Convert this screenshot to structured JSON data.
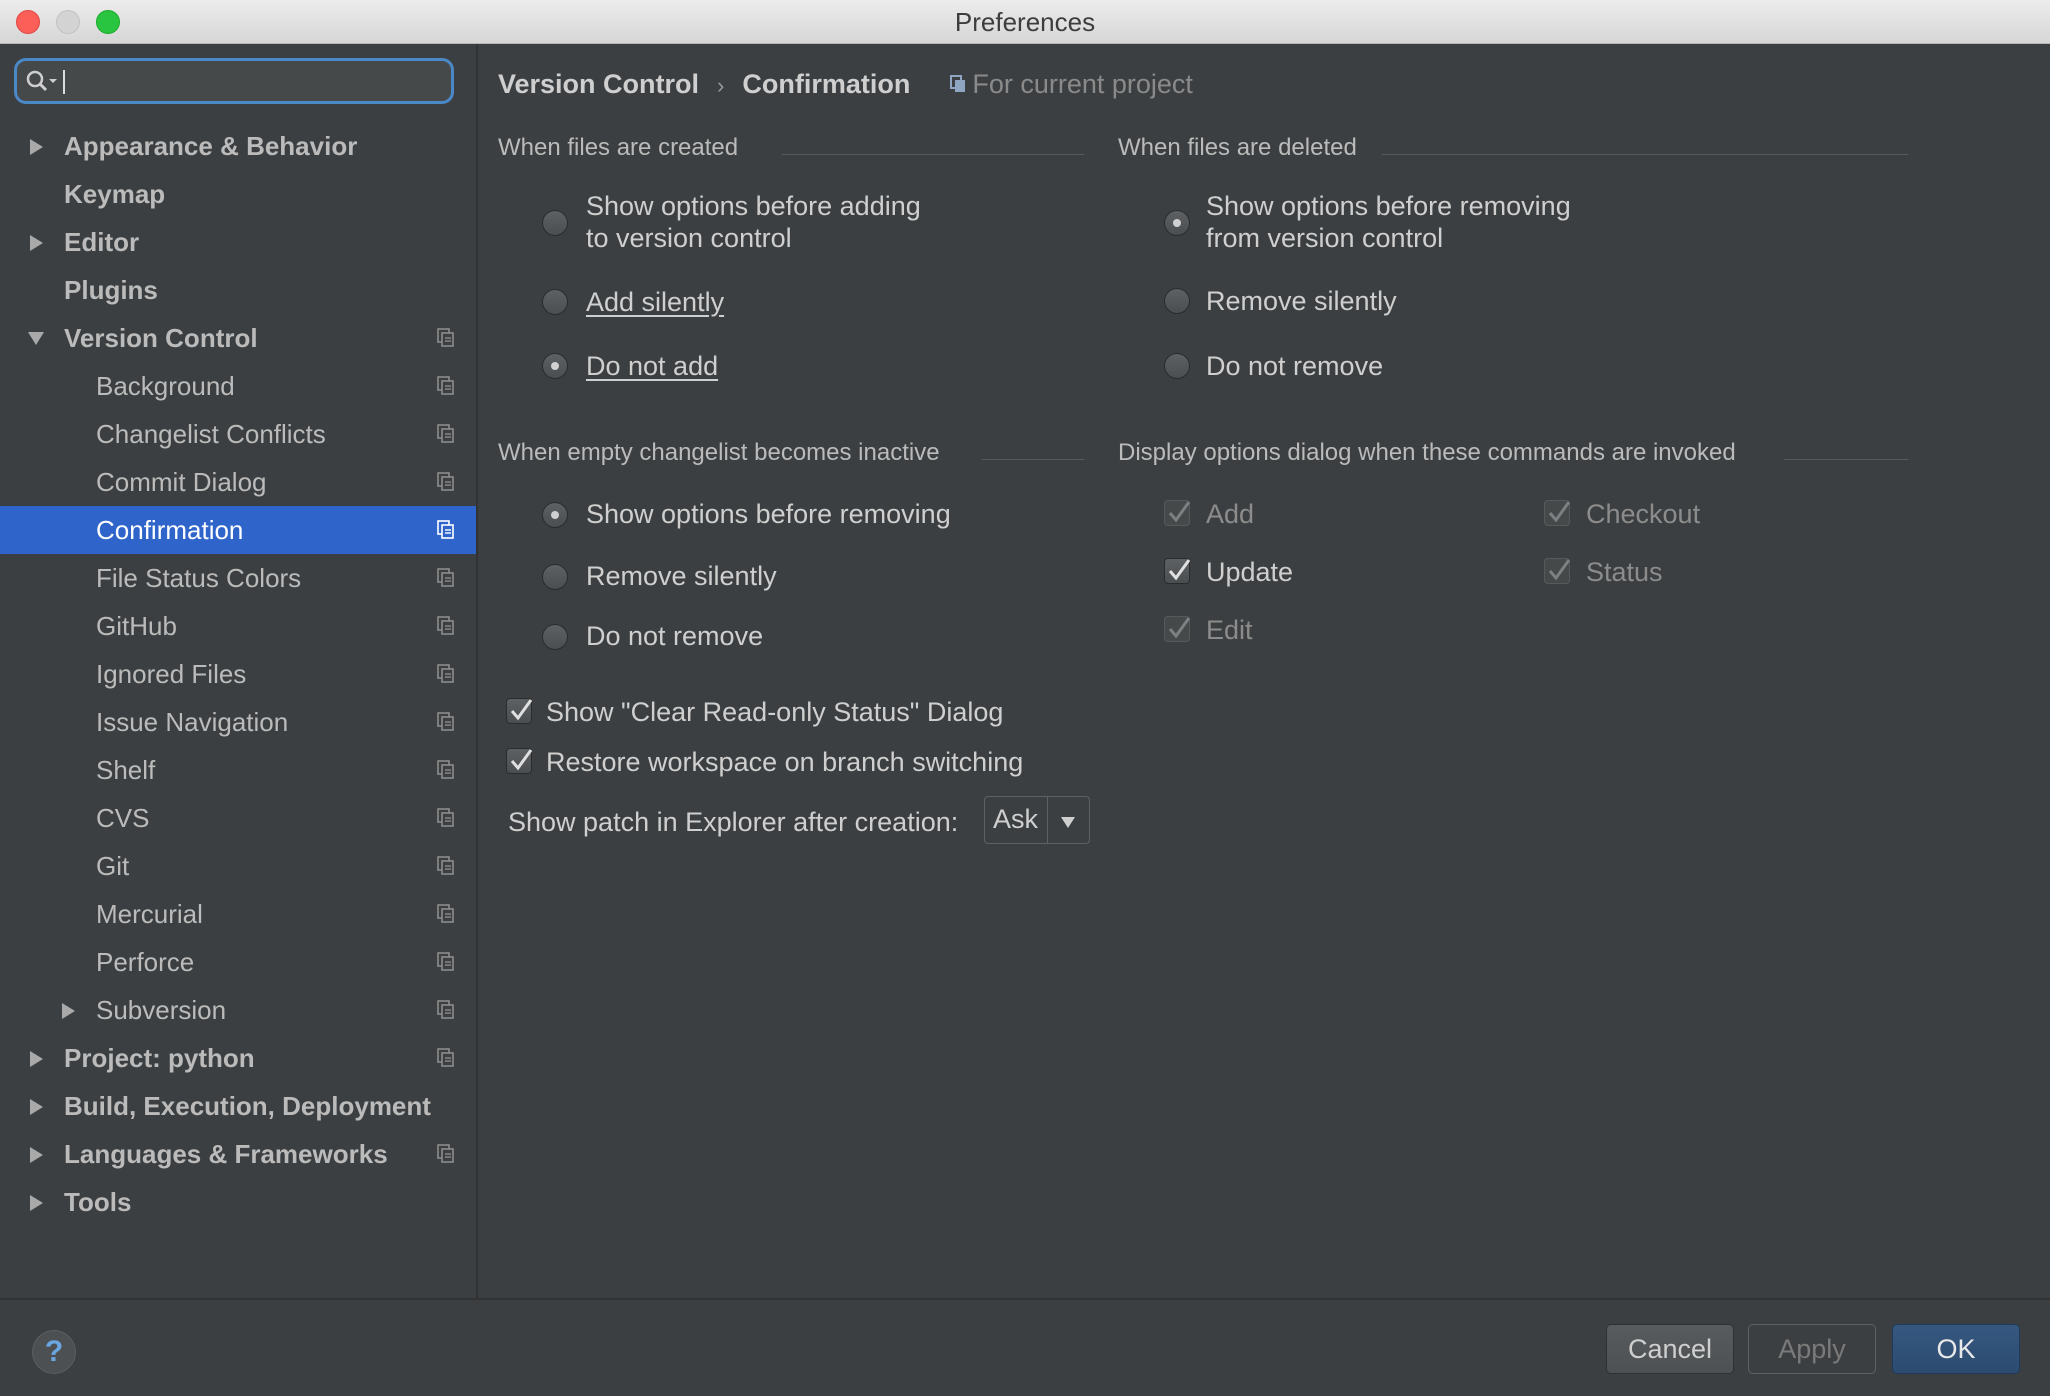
{
  "window": {
    "title": "Preferences"
  },
  "search": {
    "value": "",
    "placeholder": ""
  },
  "sidebar": {
    "items": [
      {
        "label": "Appearance & Behavior",
        "level": 0,
        "arrow": "right",
        "project_icon": false
      },
      {
        "label": "Keymap",
        "level": 0,
        "arrow": "none",
        "project_icon": false
      },
      {
        "label": "Editor",
        "level": 0,
        "arrow": "right",
        "project_icon": false
      },
      {
        "label": "Plugins",
        "level": 0,
        "arrow": "none",
        "project_icon": false
      },
      {
        "label": "Version Control",
        "level": 0,
        "arrow": "down",
        "project_icon": true
      },
      {
        "label": "Background",
        "level": 1,
        "arrow": "none",
        "project_icon": true
      },
      {
        "label": "Changelist Conflicts",
        "level": 1,
        "arrow": "none",
        "project_icon": true
      },
      {
        "label": "Commit Dialog",
        "level": 1,
        "arrow": "none",
        "project_icon": true
      },
      {
        "label": "Confirmation",
        "level": 1,
        "arrow": "none",
        "project_icon": true,
        "selected": true
      },
      {
        "label": "File Status Colors",
        "level": 1,
        "arrow": "none",
        "project_icon": true
      },
      {
        "label": "GitHub",
        "level": 1,
        "arrow": "none",
        "project_icon": true
      },
      {
        "label": "Ignored Files",
        "level": 1,
        "arrow": "none",
        "project_icon": true
      },
      {
        "label": "Issue Navigation",
        "level": 1,
        "arrow": "none",
        "project_icon": true
      },
      {
        "label": "Shelf",
        "level": 1,
        "arrow": "none",
        "project_icon": true
      },
      {
        "label": "CVS",
        "level": 1,
        "arrow": "none",
        "project_icon": true
      },
      {
        "label": "Git",
        "level": 1,
        "arrow": "none",
        "project_icon": true
      },
      {
        "label": "Mercurial",
        "level": 1,
        "arrow": "none",
        "project_icon": true
      },
      {
        "label": "Perforce",
        "level": 1,
        "arrow": "none",
        "project_icon": true
      },
      {
        "label": "Subversion",
        "level": 1,
        "arrow": "right",
        "project_icon": true
      },
      {
        "label": "Project: python",
        "level": 0,
        "arrow": "right",
        "project_icon": true
      },
      {
        "label": "Build, Execution, Deployment",
        "level": 0,
        "arrow": "right",
        "project_icon": false
      },
      {
        "label": "Languages & Frameworks",
        "level": 0,
        "arrow": "right",
        "project_icon": true
      },
      {
        "label": "Tools",
        "level": 0,
        "arrow": "right",
        "project_icon": false
      }
    ]
  },
  "breadcrumb": {
    "parent": "Version Control",
    "current": "Confirmation",
    "scope": "For current project"
  },
  "created": {
    "title": "When files are created",
    "opt1_line1": "Show options before adding",
    "opt1_line2": "to version control",
    "opt2": "Add silently",
    "opt3": "Do not add",
    "selected": 3
  },
  "deleted": {
    "title": "When files are deleted",
    "opt1_line1": "Show options before removing",
    "opt1_line2": "from version control",
    "opt2": "Remove silently",
    "opt3": "Do not remove",
    "selected": 1
  },
  "changelist": {
    "title": "When empty changelist becomes inactive",
    "opt1": "Show options before removing",
    "opt2": "Remove silently",
    "opt3": "Do not remove",
    "selected": 1
  },
  "display": {
    "title": "Display options dialog when these commands are invoked",
    "add": "Add",
    "checkout": "Checkout",
    "update": "Update",
    "status": "Status",
    "edit": "Edit"
  },
  "checks": {
    "clear_readonly": "Show \"Clear Read-only Status\" Dialog",
    "restore_workspace": "Restore workspace on branch switching"
  },
  "patch": {
    "label": "Show patch in Explorer after creation:",
    "value": "Ask"
  },
  "footer": {
    "help": "?",
    "cancel": "Cancel",
    "apply": "Apply",
    "ok": "OK"
  },
  "colors": {
    "selection": "#2f65ca",
    "background": "#3c3f41",
    "ok_button": "#365880",
    "search_focus": "#4a88c7"
  }
}
